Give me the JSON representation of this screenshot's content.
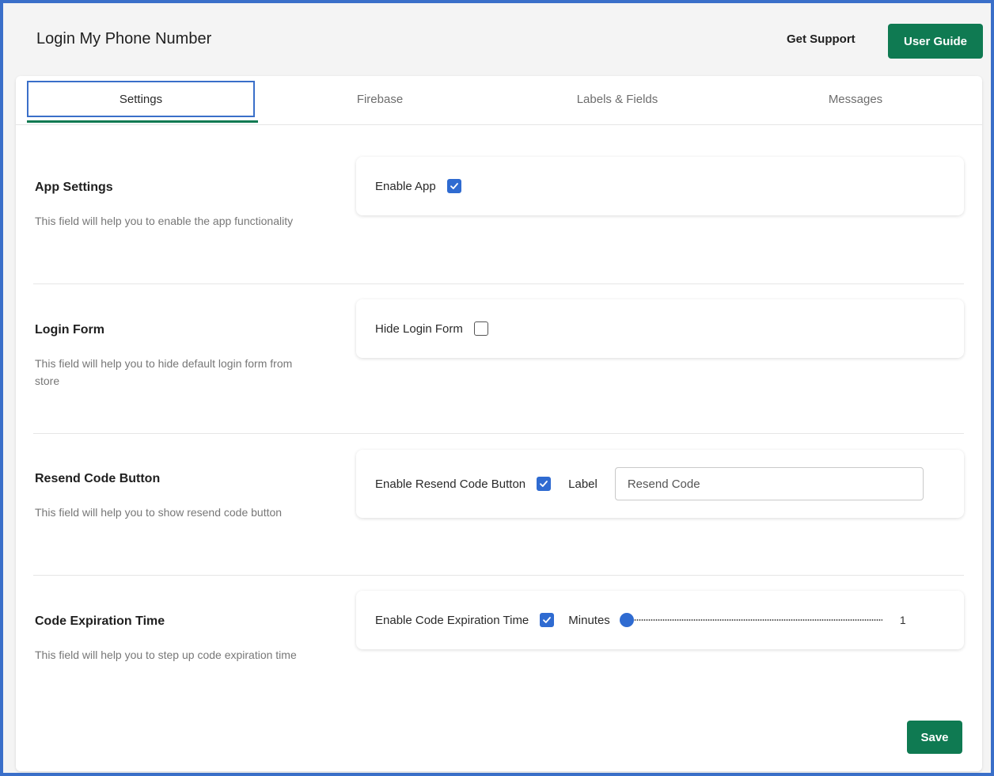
{
  "header": {
    "title": "Login My Phone Number",
    "get_support_label": "Get Support",
    "user_guide_label": "User Guide"
  },
  "tabs": [
    {
      "label": "Settings",
      "active": true
    },
    {
      "label": "Firebase",
      "active": false
    },
    {
      "label": "Labels & Fields",
      "active": false
    },
    {
      "label": "Messages",
      "active": false
    }
  ],
  "sections": {
    "app_settings": {
      "title": "App Settings",
      "description": "This field will help you to enable the app functionality",
      "option_label": "Enable App",
      "checked": true
    },
    "login_form": {
      "title": "Login Form",
      "description": "This field will help you to hide default login form from store",
      "option_label": "Hide Login Form",
      "checked": false
    },
    "resend_code": {
      "title": "Resend Code Button",
      "description": "This field will help you to show resend code button",
      "option_label": "Enable Resend Code Button",
      "checked": true,
      "label_caption": "Label",
      "label_value": "Resend Code"
    },
    "code_expiration": {
      "title": "Code Expiration Time",
      "description": "This field will help you to step up code expiration time",
      "option_label": "Enable Code Expiration Time",
      "checked": true,
      "minutes_caption": "Minutes",
      "minutes_value": "1",
      "slider_fraction": 0
    }
  },
  "footer": {
    "save_label": "Save"
  },
  "colors": {
    "accent_green": "#0f7a52",
    "focus_blue": "#3a6fc9",
    "checkbox_blue": "#2f6bd1"
  },
  "icons": [
    "check-icon"
  ]
}
